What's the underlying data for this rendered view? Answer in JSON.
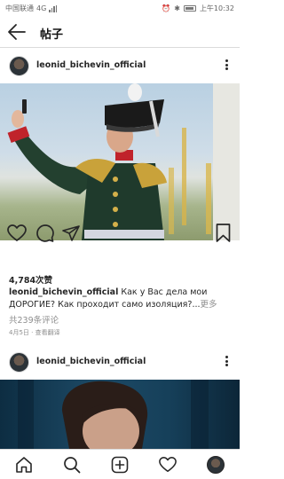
{
  "status_bar": {
    "carrier": "中国联通",
    "network": "4G",
    "time": "上午10:32",
    "battery_label": "80"
  },
  "header": {
    "title": "帖子"
  },
  "posts": [
    {
      "username": "leonid_bichevin_official",
      "likes": "4,784次赞",
      "caption_user": "leonid_bichevin_official",
      "caption_text": " Как у Вас дела мои ДОРОГИЕ? Как проходит само изоляция?...",
      "caption_more": "更多",
      "comments": "共239条评论",
      "date": "4月5日",
      "translate": " · 查看翻译"
    },
    {
      "username": "leonid_bichevin_official"
    }
  ],
  "icons": {
    "back": "back-arrow-icon",
    "more": "more-vertical-icon",
    "like": "heart-icon",
    "comment": "comment-icon",
    "share": "share-icon",
    "save": "bookmark-icon",
    "home": "home-icon",
    "search": "search-icon",
    "new_post": "new-post-icon",
    "activity": "heart-icon",
    "profile": "profile-avatar"
  },
  "colors": {
    "text": "#262626",
    "secondary": "#8e8e8e",
    "divider": "#dbdbdb"
  }
}
